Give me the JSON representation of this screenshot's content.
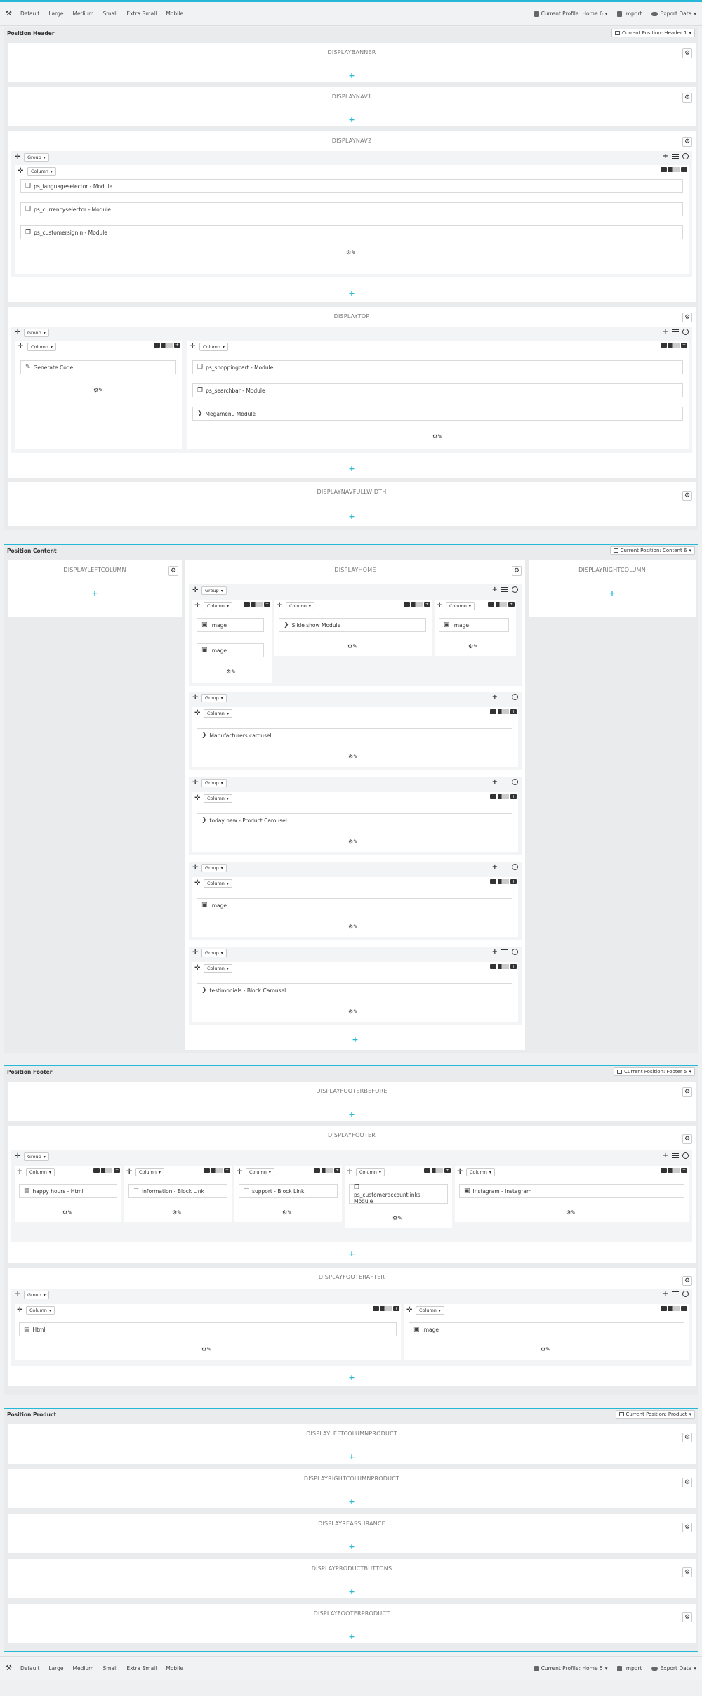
{
  "toolbar": {
    "devices": [
      "Default",
      "Large",
      "Medium",
      "Small",
      "Extra Small",
      "Mobile"
    ],
    "profile": "Current Profile: Home 6",
    "profile_bottom": "Current Profile: Home 5",
    "import": "Import",
    "export": "Export Data"
  },
  "labels": {
    "group": "Group",
    "column": "Column"
  },
  "sections": {
    "header": {
      "title": "Position Header",
      "current": "Current Position: Header 1"
    },
    "content": {
      "title": "Position Content",
      "current": "Current Position: Content 6"
    },
    "footer": {
      "title": "Position Footer",
      "current": "Current Position: Footer 5"
    },
    "product": {
      "title": "Position Product",
      "current": "Current Position: Product"
    }
  },
  "hooks": {
    "banner": "DISPLAYBANNER",
    "nav1": "DISPLAYNAV1",
    "nav2": "DISPLAYNAV2",
    "top": "DISPLAYTOP",
    "navfull": "DISPLAYNAVFULLWIDTH",
    "left": "DISPLAYLEFTCOLUMN",
    "home": "DISPLAYHOME",
    "right": "DISPLAYRIGHTCOLUMN",
    "fbefore": "DISPLAYFOOTERBEFORE",
    "footer": "DISPLAYFOOTER",
    "fafter": "DISPLAYFOOTERAFTER",
    "lcp": "DISPLAYLEFTCOLUMNPRODUCT",
    "rcp": "DISPLAYRIGHTCOLUMNPRODUCT",
    "reass": "DISPLAYREASSURANCE",
    "pbtn": "DISPLAYPRODUCTBUTTONS",
    "pfoot": "DISPLAYFOOTERPRODUCT"
  },
  "modules": {
    "lang": "ps_languageselector - Module",
    "curr": "ps_currencyselector - Module",
    "signin": "ps_customersignin - Module",
    "gencode": "Generate Code",
    "cart": "ps_shoppingcart - Module",
    "search": "ps_searchbar - Module",
    "mega": "Megamenu Module",
    "image": "Image",
    "slide": "Slide show Module",
    "manu": "Manufacturers carousel",
    "today": "today new - Product Carousel",
    "testi": "testimonials - Block Carousel",
    "happy": "happy hours - Html",
    "info": "information - Block Link",
    "support": "support - Block Link",
    "acct": "ps_customeraccountlinks - Module",
    "insta": "Instagram - Instagram",
    "html": "Html"
  }
}
